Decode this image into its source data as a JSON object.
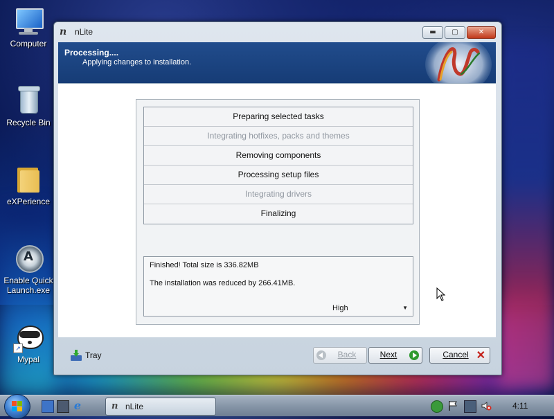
{
  "desktop": {
    "icons": [
      {
        "label": "Computer"
      },
      {
        "label": "Recycle Bin"
      },
      {
        "label": "eXPerience"
      },
      {
        "label": "Enable Quick\nLaunch.exe",
        "line1": "Enable Quick",
        "line2": "Launch.exe"
      },
      {
        "label": "Mypal"
      }
    ]
  },
  "window": {
    "title": "nLite",
    "header": {
      "title": "Processing....",
      "subtitle": "Applying changes to installation."
    },
    "tasks": [
      {
        "label": "Preparing selected tasks",
        "state": "done"
      },
      {
        "label": "Integrating hotfixes, packs and themes",
        "state": "skipped"
      },
      {
        "label": "Removing components",
        "state": "done"
      },
      {
        "label": "Processing setup files",
        "state": "done"
      },
      {
        "label": "Integrating drivers",
        "state": "skipped"
      },
      {
        "label": "Finalizing",
        "state": "done"
      }
    ],
    "result": {
      "line1": "Finished! Total size is 336.82MB",
      "line2": "The installation was reduced by 266.41MB.",
      "priority_selected": "High"
    },
    "footer": {
      "tray_label": "Tray",
      "back_label": "Back",
      "next_label": "Next",
      "cancel_label": "Cancel"
    }
  },
  "taskbar": {
    "active_task": "nLite",
    "clock": "4:11"
  },
  "colors": {
    "header_blue": "#1b4682",
    "next_green": "#2f9a2f",
    "cancel_red": "#c4211a"
  }
}
